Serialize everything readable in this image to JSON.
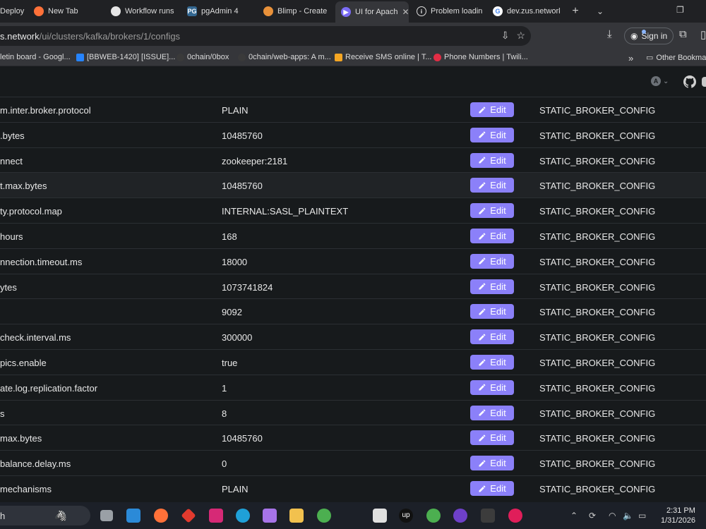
{
  "browser": {
    "tabs": [
      {
        "label": "Deploy",
        "icon": "page-icon"
      },
      {
        "label": "New Tab",
        "icon": "firefox-icon"
      },
      {
        "label": "Workflow runs",
        "icon": "github-icon"
      },
      {
        "label": "pgAdmin 4",
        "icon": "pgadmin-icon"
      },
      {
        "label": "Blimp - Create",
        "icon": "blimp-icon"
      },
      {
        "label": "UI for Apach",
        "icon": "kafka-ui-icon"
      },
      {
        "label": "Problem loadin",
        "icon": "info-icon"
      },
      {
        "label": "dev.zus.network",
        "icon": "google-icon"
      }
    ],
    "address": {
      "host": "s.network",
      "path": "/ui/clusters/kafka/brokers/1/configs"
    },
    "signin_label": "Sign in",
    "bookmarks": [
      "letin board - Googl...",
      "[BBWEB-1420] [ISSUE]...",
      "0chain/0box",
      "0chain/web-apps: A m...",
      "Receive SMS online | T...",
      "Phone Numbers | Twili...",
      "Other Bookma"
    ]
  },
  "header": {
    "theme_label": "A"
  },
  "configs": [
    {
      "name": "m.inter.broker.protocol",
      "value": "PLAIN",
      "action": "Edit",
      "source": "STATIC_BROKER_CONFIG"
    },
    {
      "name": ".bytes",
      "value": "10485760",
      "action": "Edit",
      "source": "STATIC_BROKER_CONFIG"
    },
    {
      "name": "nnect",
      "value": "zookeeper:2181",
      "action": "Edit",
      "source": "STATIC_BROKER_CONFIG"
    },
    {
      "name": "t.max.bytes",
      "value": "10485760",
      "action": "Edit",
      "source": "STATIC_BROKER_CONFIG"
    },
    {
      "name": "ty.protocol.map",
      "value": "INTERNAL:SASL_PLAINTEXT",
      "action": "Edit",
      "source": "STATIC_BROKER_CONFIG"
    },
    {
      "name": "hours",
      "value": "168",
      "action": "Edit",
      "source": "STATIC_BROKER_CONFIG"
    },
    {
      "name": "nnection.timeout.ms",
      "value": "18000",
      "action": "Edit",
      "source": "STATIC_BROKER_CONFIG"
    },
    {
      "name": "ytes",
      "value": "1073741824",
      "action": "Edit",
      "source": "STATIC_BROKER_CONFIG"
    },
    {
      "name": "",
      "value": "9092",
      "action": "Edit",
      "source": "STATIC_BROKER_CONFIG"
    },
    {
      "name": "check.interval.ms",
      "value": "300000",
      "action": "Edit",
      "source": "STATIC_BROKER_CONFIG"
    },
    {
      "name": "pics.enable",
      "value": "true",
      "action": "Edit",
      "source": "STATIC_BROKER_CONFIG"
    },
    {
      "name": "ate.log.replication.factor",
      "value": "1",
      "action": "Edit",
      "source": "STATIC_BROKER_CONFIG"
    },
    {
      "name": "s",
      "value": "8",
      "action": "Edit",
      "source": "STATIC_BROKER_CONFIG"
    },
    {
      "name": "max.bytes",
      "value": "10485760",
      "action": "Edit",
      "source": "STATIC_BROKER_CONFIG"
    },
    {
      "name": "balance.delay.ms",
      "value": "0",
      "action": "Edit",
      "source": "STATIC_BROKER_CONFIG"
    },
    {
      "name": "mechanisms",
      "value": "PLAIN",
      "action": "Edit",
      "source": "STATIC_BROKER_CONFIG"
    }
  ],
  "taskbar": {
    "search_label": "h",
    "time": "2:31 PM",
    "date": "1/31/2026"
  },
  "colors": {
    "accent": "#8b80f9",
    "background": "#171a1c",
    "row_border": "#2b2f33"
  }
}
